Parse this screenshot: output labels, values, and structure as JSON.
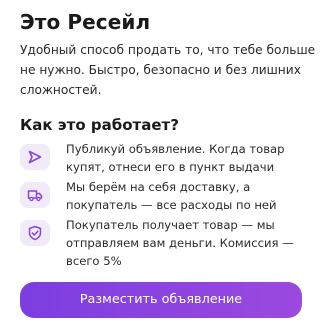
{
  "header": {
    "title": "Это Ресейл",
    "description": "Удобный способ продать то, что тебе больше не нужно. Быстро, безопасно и без лишних сложностей."
  },
  "how_it_works": {
    "title": "Как это работает?",
    "steps": [
      {
        "icon": "send-icon",
        "text": "Публикуй объявление. Когда товар купят, отнеси его в пункт выдачи"
      },
      {
        "icon": "truck-icon",
        "text": "Мы берём на себя доставку, а покупатель — все расходы по ней"
      },
      {
        "icon": "shield-check-icon",
        "text": "Покупатель получает товар — мы отправляем вам деньги. Комиссия — всего 5%"
      }
    ]
  },
  "cta": {
    "label": "Разместить объявление"
  },
  "colors": {
    "accent": "#8b43e0",
    "icon_bg": "#f1eaf9",
    "text": "#1f1f1f"
  }
}
